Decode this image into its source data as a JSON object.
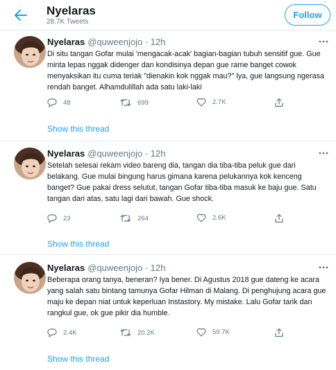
{
  "header": {
    "title": "Nyelaras",
    "subtitle": "28.7K Tweets",
    "follow_label": "Follow",
    "accent": "#1da1f2"
  },
  "tweets": [
    {
      "name": "Nyelaras",
      "handle": "@quweenjojo · 12h",
      "text": "Di situ tangan Gofar mulai 'mengacak-acak' bagian-bagian tubuh sensitif gue. Gue minta lepas nggak didenger dan kondisinya depan gue rame banget cowok menyaksikan itu cuma teriak \"dienakin kok nggak mau?\" lya, gue langsung ngerasa rendah banget. Alhamdulillah ada satu laki-laki",
      "replies": "48",
      "retweets": "699",
      "likes": "2.7K",
      "show_thread": "Show this thread"
    },
    {
      "name": "Nyelaras",
      "handle": "@quweenjojo · 12h",
      "text": "Setelah selesai rekam video bareng dia, tangan dia tiba-tiba peluk gue dari belakang. Gue mulai bingung harus gimana karena pelukannya kok kenceng banget? Gue pakai dress selutut, tangan Gofar tiba-tiba masuk ke baju gue. Satu tangan dari atas, satu lagi dari bawah. Gue shock.",
      "replies": "23",
      "retweets": "264",
      "likes": "2.6K",
      "show_thread": "Show this thread"
    },
    {
      "name": "Nyelaras",
      "handle": "@quweenjojo · 12h",
      "text": "Beberapa orang tanya, beneran? Iya bener. Di Agustus 2018 gue dateng ke acara yang salah satu bintang tamunya Gofar Hilman di Malang. Di penghujung acara gue maju ke depan niat untuk keperluan Instastory. My mistake. Lalu Gofar tarik dan rangkul gue, ok gue pikir dia humble.",
      "replies": "2.4K",
      "retweets": "20.2K",
      "likes": "59.7K",
      "show_thread": "Show this thread"
    }
  ],
  "icons": {
    "back": "back-arrow-icon",
    "more": "more-icon",
    "reply": "reply-icon",
    "retweet": "retweet-icon",
    "like": "like-icon",
    "share": "share-icon"
  }
}
